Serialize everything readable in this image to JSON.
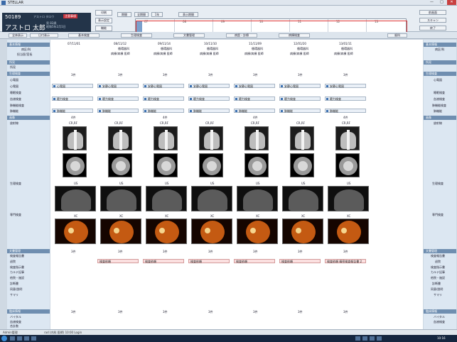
{
  "window": {
    "title": "STELLAR",
    "minimize": "—",
    "maximize": "□",
    "close": "✕"
  },
  "patient": {
    "id": "50189",
    "name": "アストロ 太郎",
    "kana": "アストロ タロウ",
    "badge": "注意事項",
    "sub": "男 82歳\n昭和5年2月1日"
  },
  "toolbar": {
    "left_buttons": [
      "印刷",
      "表示設定",
      "機能"
    ],
    "range_buttons": [
      "期間",
      "全期間",
      "1年",
      "表示期間"
    ],
    "right_buttons": [
      "前画面",
      "スキャン",
      "終了"
    ]
  },
  "timeline": {
    "labels": [
      "07",
      "08",
      "09",
      "10",
      "11",
      "12",
      "13"
    ]
  },
  "categories": [
    "全体表示",
    "日付表示",
    "基本検査",
    "生理検査",
    "文書管理",
    "病歴・診療",
    "病棟検査",
    "歯科"
  ],
  "dates": [
    "07/11/01",
    "08/11/12",
    "09/11/14",
    "10/11/10",
    "11/11/09",
    "12/01/20",
    "13/01/11"
  ],
  "sections": {
    "basic": {
      "title": "基本情報",
      "rows": [
        "病区/科",
        "担当医/室長"
      ],
      "cell1": "循環器科",
      "cell2": "病棟/病棟 医師"
    },
    "memo": {
      "title": "所見",
      "rows": [
        "所見"
      ]
    },
    "physio": {
      "title": "生理検査",
      "rows": [
        "心電図",
        "心電図",
        "睡眠検査",
        "血液検査",
        "肺機能検査",
        "肺機能"
      ],
      "count": "3件",
      "tags": [
        "心電図",
        "安静心電図",
        "標準聴力",
        "聴力検査",
        "肺機能"
      ]
    },
    "imaging": {
      "title": "画像",
      "rows": [
        "放射線",
        "生理検査",
        "専門検査"
      ],
      "count": "4件",
      "modality_xr": "CR,RF",
      "modality_us": "US",
      "modality_xc": "XC"
    },
    "docs": {
      "title": "文書管理",
      "rows": [
        "検査報告書",
        "退院",
        "検査指示書",
        "カルテ記事",
        "他院・施設",
        "診断書",
        "同意/説明",
        "サマリ"
      ],
      "count": "3件",
      "note": "検査依頼",
      "note_last": "検査依頼 精密検査報告書 2"
    },
    "bottom": {
      "title": "臨床情報",
      "rows": [
        "バイタル",
        "血液検査",
        "合計数"
      ],
      "count": "3件"
    }
  },
  "right": {
    "labels": [
      "基本情報",
      "病区/科",
      "所見",
      "生理検査",
      "心電図",
      "睡眠検査",
      "血液検査",
      "肺機能検査",
      "肺機能",
      "画像",
      "放射線",
      "生理検査",
      "専門検査",
      "文書管理",
      "検査報告書",
      "退院",
      "検査指示書",
      "カルテ記事",
      "他院・施設",
      "診断書",
      "同意/説明",
      "サマリ",
      "臨床情報",
      "バイタル",
      "血液検査"
    ]
  },
  "status": {
    "user": "Admin管理",
    "login": "rad (内科 医師) 10:00 Login"
  },
  "taskbar": {
    "clock": "10:16"
  }
}
